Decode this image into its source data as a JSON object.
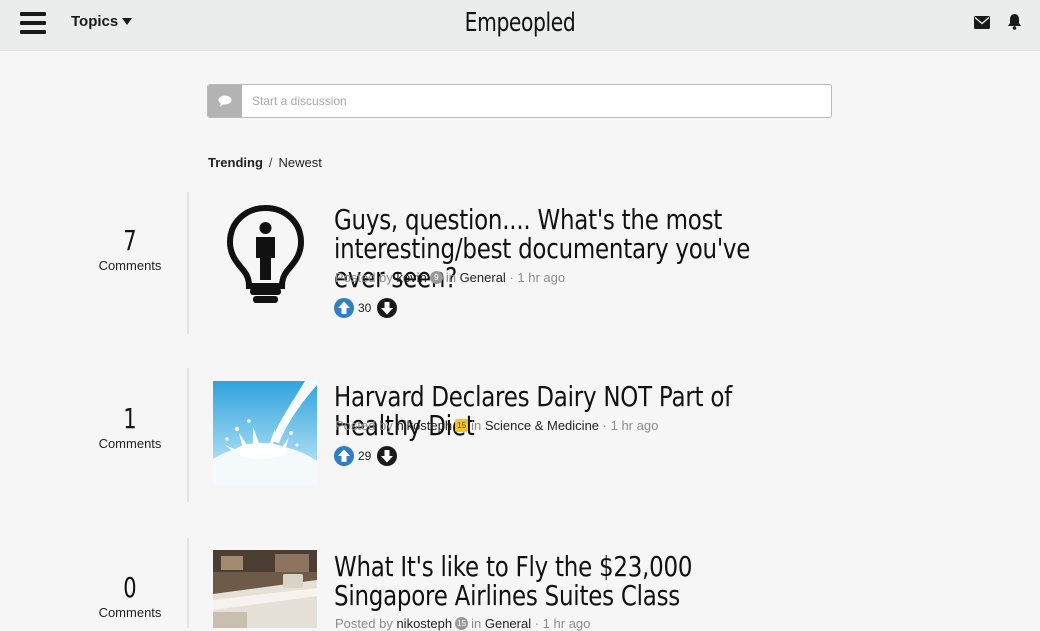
{
  "header": {
    "topics_label": "Topics",
    "brand": "Empeopled",
    "icons": [
      "hamburger-icon",
      "caret-down-icon",
      "envelope-icon",
      "bell-icon"
    ]
  },
  "composer": {
    "placeholder": "Start a discussion",
    "icon": "chat-bubble-icon"
  },
  "sort": {
    "trending": "Trending",
    "separator": "/",
    "newest": "Newest"
  },
  "posts": [
    {
      "comment_count": "7",
      "comments_label": "Comments",
      "title": "Guys, question.... What's the most interesting/best documentary you've ever seen?",
      "posted_by": "Posted by",
      "author": "kevin",
      "badge": "9",
      "in": "in",
      "topic": "General",
      "time": "· 1 hr ago",
      "votes": "30",
      "thumbnail": "lightbulb-person-icon"
    },
    {
      "comment_count": "1",
      "comments_label": "Comments",
      "title": "Harvard Declares Dairy NOT Part of Healthy Diet",
      "posted_by": "Posted by",
      "author": "nikosteph",
      "badge": "15",
      "in": "in",
      "topic": "Science & Medicine",
      "time": "· 1 hr ago",
      "votes": "29",
      "thumbnail": "milk-splash-image"
    },
    {
      "comment_count": "0",
      "comments_label": "Comments",
      "title": "What It's like to Fly the $23,000 Singapore Airlines Suites Class",
      "posted_by": "Posted by",
      "author": "nikosteph",
      "badge": "15",
      "in": "in",
      "topic": "General",
      "time": "· 1 hr ago",
      "thumbnail": "airline-suite-image"
    }
  ],
  "colors": {
    "topbar": "#ebecec",
    "background": "#f6f6f6",
    "upvote": "#2f7fc1",
    "downvote": "#1a1a1a"
  }
}
